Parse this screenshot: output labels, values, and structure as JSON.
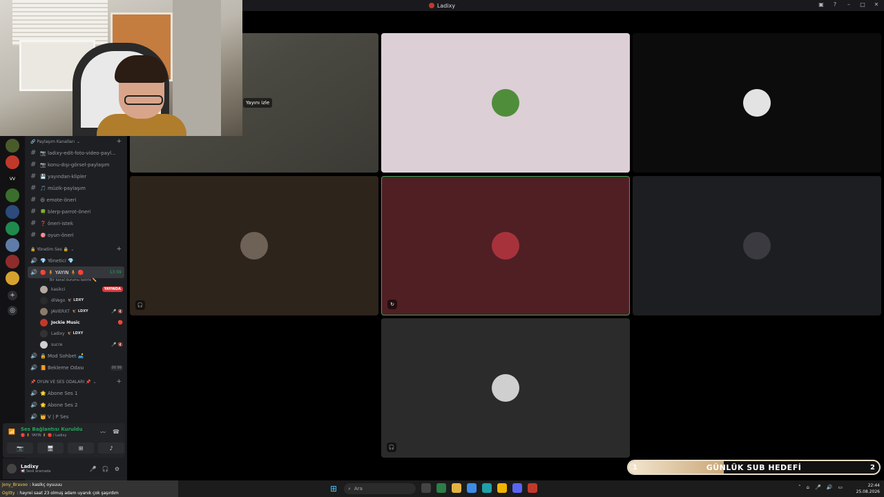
{
  "window": {
    "title": "Ladixy"
  },
  "webcam_overlay": {},
  "servers": [
    {
      "color": "#4a5b2a"
    },
    {
      "color": "#c0392b"
    },
    {
      "color": "#111111",
      "label": "VV"
    },
    {
      "color": "#3b6e2c"
    },
    {
      "color": "#2c4a7a"
    },
    {
      "color": "#1f8a4c"
    },
    {
      "color": "#5f7ca8"
    },
    {
      "color": "#8e2c2c"
    },
    {
      "color": "#d6a12f"
    }
  ],
  "sidebar": {
    "share_category": "Paylaşım Kanalları",
    "text_channels": [
      "📷 ladixy-edit-foto-video-payl...",
      "📷 konu-dışı-görsel-paylaşım",
      "💾 yayından-klipler",
      "🎵 müzik-paylaşım",
      "😆 emote-öneri",
      "🍀 blerp-parrot-öneri",
      "❓ öneri-istek",
      "🎯 oyun-öneri"
    ],
    "admin_category": "🔒 Yönetim Ses 🔒",
    "admin_channel": "💎 Yönetici 💎",
    "stream_channel": "🔴 🧍 YAYIN 🧍 🔴",
    "stream_channel_time": "13:59",
    "stream_channel_status": "Bir kanal durumu belirle ✏️",
    "users": [
      {
        "name": "kasikci",
        "badge": "YAYINDA",
        "avatar_color": "#b3a9a0"
      },
      {
        "name": "diVego",
        "tag": "🦅 LDXY",
        "avatar_color": "#2b2b2b"
      },
      {
        "name": "JAVIERXT",
        "tag": "🦅 LDXY",
        "avatar_color": "#8a7b6a",
        "icons": "🎤 🔇"
      },
      {
        "name": "Jockie Music",
        "avatar_color": "#c0392b",
        "icons": "🔴"
      },
      {
        "name": "Ladixy",
        "tag": "🦅 LDXY",
        "avatar_color": "#333333"
      },
      {
        "name": "sucre",
        "avatar_color": "#d0d0d0",
        "icons": "🎤 🔇"
      }
    ],
    "voice_channels": [
      {
        "name": "🔒 Mod Sohbet 🛋️"
      },
      {
        "name": "📙 Bekleme Odası",
        "limit": "00 99"
      }
    ],
    "game_category": "📌 OYUN VE SES ODALARI 📌",
    "game_channels": [
      "🌟 Abone Ses 1",
      "🌟 Abone Ses 2",
      "👑 V | P Ses"
    ]
  },
  "voice_panel": {
    "status": "Ses Bağlantısı Kuruldu",
    "channel": "🔴 🧍 YAYIN 🧍 🔴 / Ladixy"
  },
  "user_panel": {
    "name": "Ladixy",
    "status": "📢 Sesli aramada"
  },
  "call": {
    "stream_tile": {
      "watch_label": "Yayını izle"
    },
    "tiles": [
      {
        "bg": "#dccfd6",
        "avatar": "#4f8d3b"
      },
      {
        "bg": "#0c0c0c",
        "avatar": "#e3e3e3"
      },
      {
        "bg": "#2d241c",
        "avatar": "#6e6257"
      },
      {
        "bg": "#4f1f24",
        "avatar": "#a8323c",
        "speaking": true
      },
      {
        "bg": "#1d1e22",
        "avatar": "#3a3a40"
      },
      {
        "bg": "#2b2b2b",
        "avatar": "#cfcfcf"
      }
    ]
  },
  "sub_goal": {
    "title": "GÜNLÜK SUB HEDEFİ",
    "current": "1",
    "target": "2",
    "progress": 0.38
  },
  "chat": [
    {
      "user": "Jony_Bravoo",
      "text": ": kasikç oyuuuu"
    },
    {
      "user": "Ogitty",
      "text": ": hayrei saat 23 olmuş adam uyanık çok şaşırdım"
    }
  ],
  "taskbar": {
    "search_placeholder": "Ara",
    "time": "22:44",
    "date": "25.08.2026"
  }
}
